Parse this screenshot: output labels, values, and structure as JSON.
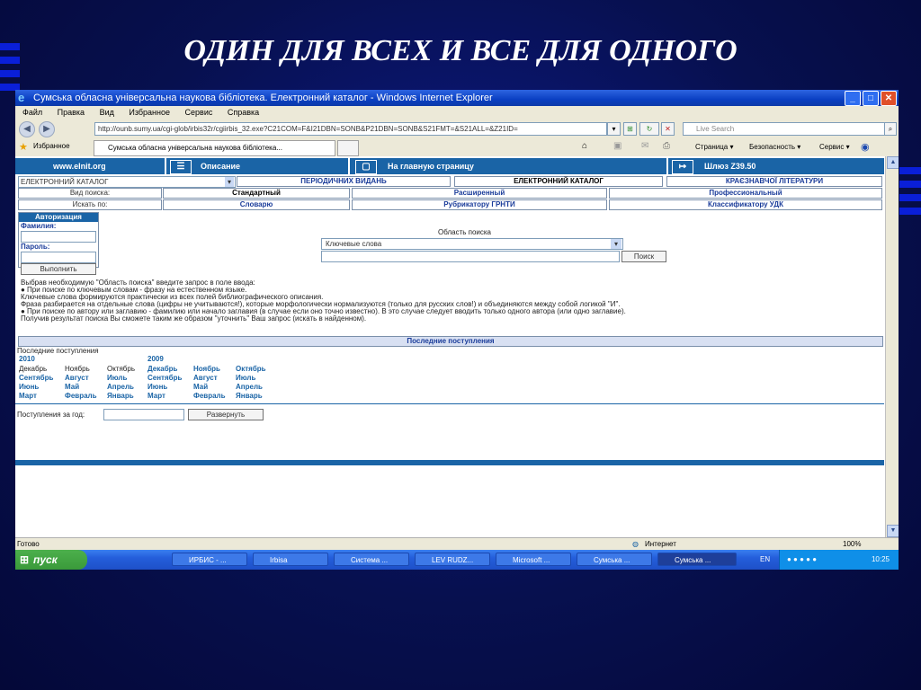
{
  "slide": {
    "title": "ОДИН ДЛЯ ВСЕХ И ВСЕ ДЛЯ ОДНОГО"
  },
  "window": {
    "title": "Сумська обласна універсальна наукова бібліотека. Електронний каталог - Windows Internet Explorer"
  },
  "menu": [
    "Файл",
    "Правка",
    "Вид",
    "Избранное",
    "Сервис",
    "Справка"
  ],
  "address": {
    "url": "http://ounb.sumy.ua/cgi-glob/irbis32r/cgiirbis_32.exe?C21COM=F&I21DBN=SONB&P21DBN=SONB&S21FMT=&S21ALL=&Z21ID=",
    "search_placeholder": "Live Search"
  },
  "favbar": {
    "favorites": "Избранное",
    "tab": "Сумська обласна універсальна наукова бібліотека...",
    "tools": [
      "Страница ▾",
      "Безопасность ▾",
      "Сервис ▾"
    ]
  },
  "topnav": {
    "site": "www.elnit.org",
    "description": "Описание",
    "home": "На главную страницу",
    "gateway": "Шлюз Z39.50"
  },
  "catalog": {
    "select_value": "ЕЛЕКТРОННИЙ КАТАЛОГ",
    "db_tabs": [
      "ПЕРІОДИЧНИХ ВИДАНЬ",
      "ЕЛЕКТРОННИЙ КАТАЛОГ",
      "КРАЄЗНАВЧОЇ ЛІТЕРАТУРИ"
    ],
    "search_type_label": "Вид поиска:",
    "search_types": [
      "Стандартный",
      "Расширенный",
      "Профессиональный"
    ],
    "search_in_label": "Искать по:",
    "search_in": [
      "Словарю",
      "Рубрикатору ГРНТИ",
      "Классификатору УДК"
    ]
  },
  "auth": {
    "title": "Авторизация",
    "surname": "Фамилия:",
    "password": "Пароль:",
    "submit": "Выполнить"
  },
  "search": {
    "area_label": "Область поиска",
    "area_value": "Ключевые слова",
    "button": "Поиск"
  },
  "help": [
    "Выбрав необходимую \"Область поиска\" введите запрос в поле ввода:",
    "●   При поиске по ключевым словам - фразу на естественном языке.",
    "Ключевые слова формируются практически из всех полей библиографического описания.",
    "Фраза разбирается на отдельные слова (цифры не учитываются!), которые морфологически нормализуются (только для русских слов!) и объединяются между собой логикой \"И\".",
    "●   При поиске по автору или заглавию - фамилию или начало заглавия (в случае если оно точно известно). В это случае следует вводить только одного автора (или одно заглавие).",
    "Получив результат поиска Вы сможете таким же образом \"уточнить\" Ваш запрос (искать в найденном)."
  ],
  "recent": {
    "header": "Последние поступления",
    "label": "Последние поступления",
    "year1": "2010",
    "col1": [
      "Декабрь",
      "Сентябрь",
      "Июнь",
      "Март"
    ],
    "col2": [
      "Ноябрь",
      "Август",
      "Май",
      "Февраль"
    ],
    "col3": [
      "Октябрь",
      "Июль",
      "Апрель",
      "Январь"
    ],
    "year2": "2009",
    "col4": [
      "Декабрь",
      "Сентябрь",
      "Июнь",
      "Март"
    ],
    "col5": [
      "Ноябрь",
      "Август",
      "Май",
      "Февраль"
    ],
    "col6": [
      "Октябрь",
      "Июль",
      "Апрель",
      "Январь"
    ],
    "year_label": "Поступления за год:",
    "expand": "Развернуть"
  },
  "status": {
    "ready": "Готово",
    "zone": "Интернет",
    "zoom": "100%"
  },
  "taskbar": {
    "start": "пуск",
    "items": [
      "ИРБИС - ...",
      "Irbisa",
      "Система ...",
      "LEV RUDZ...",
      "Microsoft ...",
      "Сумська ...",
      "Сумська ..."
    ],
    "lang": "EN",
    "time": "10:25"
  }
}
